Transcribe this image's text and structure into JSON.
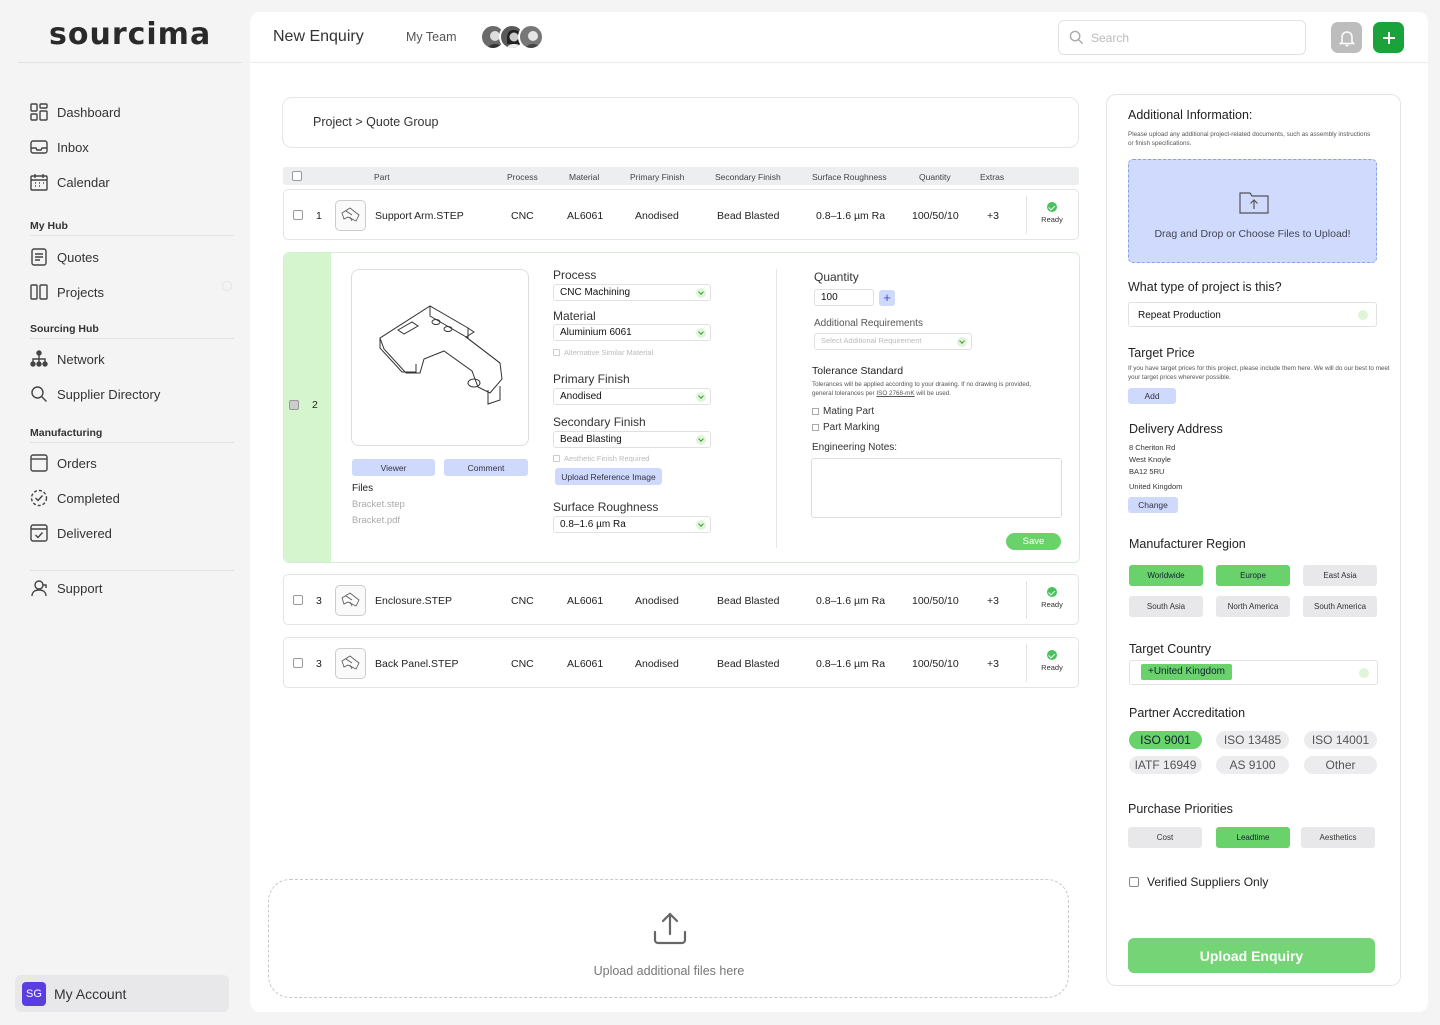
{
  "brand": {
    "logo": "sourcima",
    "accent": "#1aa33a",
    "green_light": "#6ad26a",
    "blue_light": "#cfd9fb"
  },
  "sidebar": {
    "top": [
      {
        "label": "Dashboard",
        "icon": "dashboard-icon"
      },
      {
        "label": "Inbox",
        "icon": "inbox-icon"
      },
      {
        "label": "Calendar",
        "icon": "calendar-icon"
      }
    ],
    "my_hub": {
      "heading": "My Hub",
      "items": [
        {
          "label": "Quotes",
          "icon": "quotes-icon"
        },
        {
          "label": "Projects",
          "icon": "projects-icon"
        }
      ]
    },
    "sourcing_hub": {
      "heading": "Sourcing Hub",
      "items": [
        {
          "label": "Network",
          "icon": "network-icon"
        },
        {
          "label": "Supplier Directory",
          "icon": "search-icon"
        }
      ]
    },
    "manufacturing": {
      "heading": "Manufacturing",
      "items": [
        {
          "label": "Orders",
          "icon": "orders-icon"
        },
        {
          "label": "Completed",
          "icon": "completed-icon"
        },
        {
          "label": "Delivered",
          "icon": "delivered-icon"
        }
      ]
    },
    "support": {
      "label": "Support",
      "icon": "support-icon"
    },
    "account": {
      "initials": "SG",
      "label": "My Account"
    }
  },
  "header": {
    "title": "New Enquiry",
    "team_label": "My Team",
    "search_placeholder": "Search"
  },
  "breadcrumb": "Project > Quote Group",
  "table": {
    "headers": [
      "Part",
      "Process",
      "Material",
      "Primary Finish",
      "Secondary Finish",
      "Surface Roughness",
      "Quantity",
      "Extras"
    ],
    "rows": [
      {
        "num": "1",
        "part": "Support Arm.STEP",
        "process": "CNC",
        "material": "AL6061",
        "primary": "Anodised",
        "secondary": "Bead Blasted",
        "roughness": "0.8–1.6 µm Ra",
        "qty": "100/50/10",
        "extras": "+3",
        "status": "Ready"
      },
      {
        "num": "3",
        "part": "Enclosure.STEP",
        "process": "CNC",
        "material": "AL6061",
        "primary": "Anodised",
        "secondary": "Bead Blasted",
        "roughness": "0.8–1.6 µm Ra",
        "qty": "100/50/10",
        "extras": "+3",
        "status": "Ready"
      },
      {
        "num": "3",
        "part": "Back Panel.STEP",
        "process": "CNC",
        "material": "AL6061",
        "primary": "Anodised",
        "secondary": "Bead Blasted",
        "roughness": "0.8–1.6 µm Ra",
        "qty": "100/50/10",
        "extras": "+3",
        "status": "Ready"
      }
    ]
  },
  "expanded": {
    "num": "2",
    "viewer_btn": "Viewer",
    "comment_btn": "Comment",
    "files_label": "Files",
    "files": [
      "Bracket.step",
      "Bracket.pdf"
    ],
    "process_label": "Process",
    "process_value": "CNC Machining",
    "material_label": "Material",
    "material_value": "Aluminium 6061",
    "alt_material": "Alternative Similar Material",
    "primary_label": "Primary Finish",
    "primary_value": "Anodised",
    "secondary_label": "Secondary Finish",
    "secondary_value": "Bead Blasting",
    "aesthetic": "Aesthetic Finish Required",
    "upload_ref": "Upload Reference Image",
    "roughness_label": "Surface Roughness",
    "roughness_value": "0.8–1.6 µm Ra",
    "quantity_label": "Quantity",
    "quantity_value": "100",
    "addreq_label": "Additional Requirements",
    "addreq_placeholder": "Select Additional Requirement",
    "tolerance_label": "Tolerance Standard",
    "tolerance_text_1": "Tolerances will be applied according to your drawing. If no drawing is provided,",
    "tolerance_text_2a": "general tolerances per ",
    "tolerance_link": "ISO 2768-mK",
    "tolerance_text_2b": " will be used.",
    "mating": "Mating Part",
    "marking": "Part Marking",
    "notes_label": "Engineering Notes:",
    "save": "Save"
  },
  "bottom_upload": "Upload additional files here",
  "panel": {
    "add_info_title": "Additional Information:",
    "add_info_text_1": "Please upload any additional project-related documents, such as assembly instructions",
    "add_info_text_2": "or finish specifications.",
    "drop_text": "Drag and Drop or Choose Files to Upload!",
    "project_type_label": "What type of project is this?",
    "project_type_value": "Repeat Production",
    "target_price_label": "Target Price",
    "target_price_text_1": "If you have target prices for this project, please include them here. We will do our best to meet",
    "target_price_text_2": "your target prices wherever possible.",
    "add_btn": "Add",
    "delivery_label": "Delivery Address",
    "address": [
      "8 Cheriton Rd",
      "West Knoyle",
      "BA12 5RU",
      "United Kingdom"
    ],
    "change_btn": "Change",
    "region_label": "Manufacturer Region",
    "regions": [
      {
        "label": "Worldwide",
        "on": true
      },
      {
        "label": "Europe",
        "on": true
      },
      {
        "label": "East Asia",
        "on": false
      },
      {
        "label": "South Asia",
        "on": false
      },
      {
        "label": "North America",
        "on": false
      },
      {
        "label": "South America",
        "on": false
      }
    ],
    "country_label": "Target Country",
    "country_tag": "+United Kingdom",
    "accred_label": "Partner Accreditation",
    "accreds": [
      {
        "label": "ISO 9001",
        "on": true
      },
      {
        "label": "ISO 13485",
        "on": false
      },
      {
        "label": "ISO 14001",
        "on": false
      },
      {
        "label": "IATF 16949",
        "on": false
      },
      {
        "label": "AS 9100",
        "on": false
      },
      {
        "label": "Other",
        "on": false
      }
    ],
    "priorities_label": "Purchase Priorities",
    "priorities": [
      {
        "label": "Cost",
        "on": false
      },
      {
        "label": "Leadtime",
        "on": true
      },
      {
        "label": "Aesthetics",
        "on": false
      }
    ],
    "verified_label": "Verified Suppliers Only",
    "upload_btn": "Upload Enquiry"
  }
}
